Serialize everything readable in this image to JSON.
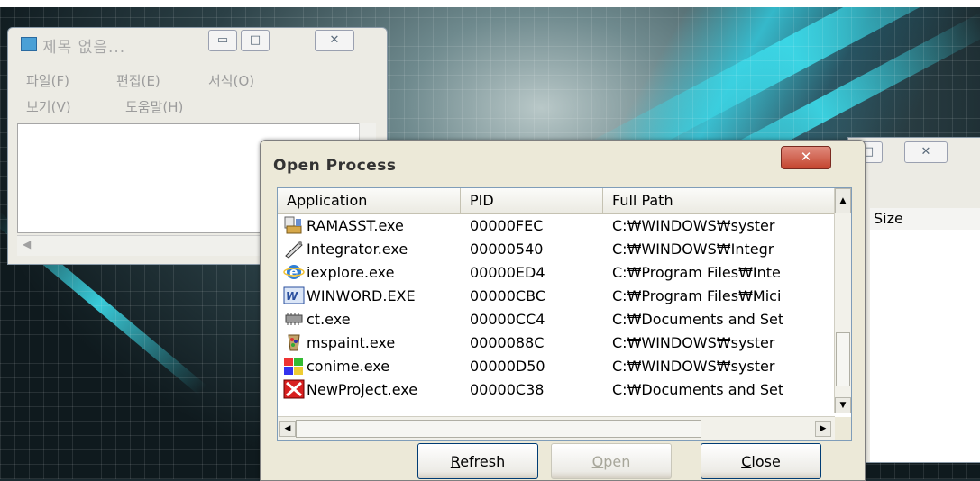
{
  "notepad": {
    "title": "제목 없음...",
    "menu_file": "파일(F)",
    "menu_edit": "편집(E)",
    "menu_format": "서식(O)",
    "menu_view": "보기(V)",
    "menu_help": "도움말(H)"
  },
  "background_window": {
    "column_size": "Size"
  },
  "dialog": {
    "title": "Open Process",
    "close_glyph": "✕",
    "columns": [
      "Application",
      "PID",
      "Full Path"
    ],
    "rows": [
      {
        "name": "RAMASST.exe",
        "pid": "00000FEC",
        "path": "C:₩WINDOWS₩syster",
        "icon": "ramasst-icon"
      },
      {
        "name": "Integrator.exe",
        "pid": "00000540",
        "path": "C:₩WINDOWS₩Integr",
        "icon": "integrator-icon"
      },
      {
        "name": "iexplore.exe",
        "pid": "00000ED4",
        "path": "C:₩Program Files₩Inte",
        "icon": "internet-explorer-icon"
      },
      {
        "name": "WINWORD.EXE",
        "pid": "00000CBC",
        "path": "C:₩Program Files₩Mici",
        "icon": "word-icon"
      },
      {
        "name": "ct.exe",
        "pid": "00000CC4",
        "path": "C:₩Documents and Set",
        "icon": "chip-icon"
      },
      {
        "name": "mspaint.exe",
        "pid": "0000088C",
        "path": "C:₩WINDOWS₩syster",
        "icon": "paint-icon"
      },
      {
        "name": "conime.exe",
        "pid": "00000D50",
        "path": "C:₩WINDOWS₩syster",
        "icon": "conime-icon"
      },
      {
        "name": "NewProject.exe",
        "pid": "00000C38",
        "path": "C:₩Documents and Set",
        "icon": "newproject-icon"
      }
    ],
    "buttons": {
      "refresh": "Refresh",
      "open": "Open",
      "close": "Close"
    }
  }
}
